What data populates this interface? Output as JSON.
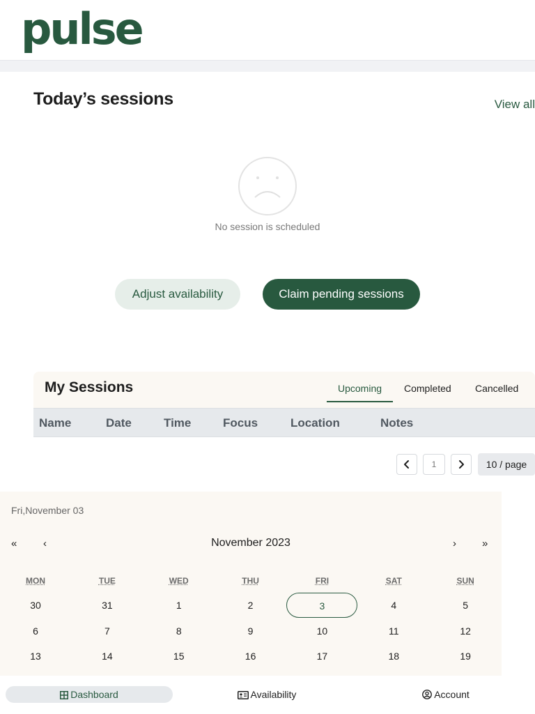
{
  "app": {
    "logo": "pulse"
  },
  "today": {
    "title": "Today’s sessions",
    "view_all": "View all",
    "empty_icon": "sad-face-icon",
    "empty_text": "No session is scheduled",
    "adjust_label": "Adjust availability",
    "claim_label": "Claim pending sessions"
  },
  "sessions": {
    "title": "My Sessions",
    "tabs": [
      "Upcoming",
      "Completed",
      "Cancelled"
    ],
    "active_tab": "Upcoming",
    "columns": [
      "Name",
      "Date",
      "Time",
      "Focus",
      "Location",
      "Notes"
    ],
    "rows": []
  },
  "pagination": {
    "prev_icon": "chevron-left-icon",
    "page": "1",
    "next_icon": "chevron-right-icon",
    "page_size": "10 / page"
  },
  "calendar": {
    "selected_label": "Fri,November 03",
    "month_label": "November 2023",
    "nav": {
      "prev_year": "«",
      "prev_month": "‹",
      "next_month": "›",
      "next_year": "»"
    },
    "weekdays": [
      "MON",
      "TUE",
      "WED",
      "THU",
      "FRI",
      "SAT",
      "SUN"
    ],
    "weeks": [
      [
        "30",
        "31",
        "1",
        "2",
        "3",
        "4",
        "5"
      ],
      [
        "6",
        "7",
        "8",
        "9",
        "10",
        "11",
        "12"
      ],
      [
        "13",
        "14",
        "15",
        "16",
        "17",
        "18",
        "19"
      ]
    ],
    "today": "3"
  },
  "bottom_nav": {
    "items": [
      {
        "label": "Dashboard",
        "icon": "grid-icon",
        "active": true
      },
      {
        "label": "Availability",
        "icon": "id-card-icon",
        "active": false
      },
      {
        "label": "Account",
        "icon": "user-circle-icon",
        "active": false
      }
    ]
  },
  "colors": {
    "brand": "#28593f",
    "brand_light": "#e6eee9",
    "cream": "#fbf8f3",
    "table_header": "#e6e9ec"
  }
}
